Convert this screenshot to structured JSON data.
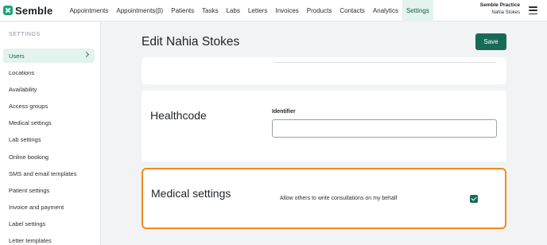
{
  "app": {
    "brand": "Semble"
  },
  "nav": {
    "items": [
      {
        "label": "Appointments"
      },
      {
        "label": "Appointments(β)"
      },
      {
        "label": "Patients"
      },
      {
        "label": "Tasks"
      },
      {
        "label": "Labs"
      },
      {
        "label": "Letters"
      },
      {
        "label": "Invoices"
      },
      {
        "label": "Products"
      },
      {
        "label": "Contacts"
      },
      {
        "label": "Analytics"
      },
      {
        "label": "Settings",
        "active": true
      }
    ]
  },
  "account": {
    "practice": "Semble Practice",
    "user": "Nahia Stokes"
  },
  "sidebar": {
    "heading": "SETTINGS",
    "items": [
      {
        "label": "Users",
        "active": true
      },
      {
        "label": "Locations"
      },
      {
        "label": "Availability"
      },
      {
        "label": "Access groups"
      },
      {
        "label": "Medical settings"
      },
      {
        "label": "Lab settings"
      },
      {
        "label": "Online booking"
      },
      {
        "label": "SMS and email templates"
      },
      {
        "label": "Patient settings"
      },
      {
        "label": "Invoice and payment"
      },
      {
        "label": "Label settings"
      },
      {
        "label": "Letter templates"
      }
    ]
  },
  "page": {
    "title": "Edit Nahia Stokes",
    "save_label": "Save"
  },
  "healthcode": {
    "title": "Healthcode",
    "field_label": "Identifier",
    "field_value": ""
  },
  "medical": {
    "title": "Medical settings",
    "toggle_label": "Allow others to write consultations on my behalf",
    "checked": true
  },
  "colors": {
    "accent": "#176a56",
    "highlight": "#f28c1c",
    "nav_active_bg": "#e3f3ee"
  }
}
